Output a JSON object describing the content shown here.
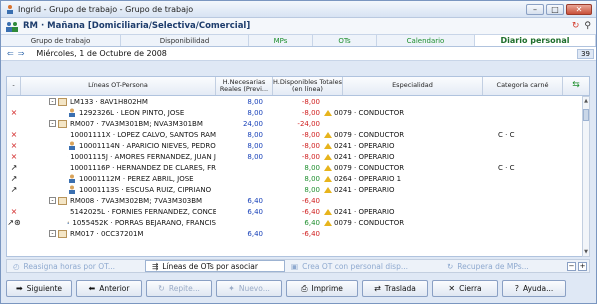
{
  "window": {
    "title": "Ingrid - Grupo de trabajo - Grupo de trabajo"
  },
  "header": {
    "title": "RM · Mañana [Domiciliaria/Selectiva/Comercial]"
  },
  "tabs": [
    {
      "label": "Grupo de trabajo",
      "style": "normal"
    },
    {
      "label": "Disponibilidad",
      "style": "normal"
    },
    {
      "label": "MPs",
      "style": "green"
    },
    {
      "label": "OTs",
      "style": "green"
    },
    {
      "label": "Calendario",
      "style": "green"
    },
    {
      "label": "Diario personal",
      "style": "active"
    }
  ],
  "datebar": {
    "date": "Miércoles, 1 de Octubre de 2008",
    "week": "39"
  },
  "columns": {
    "c0": "-",
    "c1": "Líneas OT-Persona",
    "c2": "H.Necesarias Reales (Previ...",
    "c3": "H.Disponibles Totales (en línea)",
    "c4": "Especialidad",
    "c5": "Categoría carné"
  },
  "rows": [
    {
      "mark": "",
      "level": 1,
      "expand": "-",
      "icon": "route",
      "text": "LM133 · 8AV1H802HM",
      "nec": "8,00",
      "disp": "-8,00",
      "disp_color": "red",
      "warn": false,
      "esp": "",
      "cat": ""
    },
    {
      "mark": "×",
      "mark_color": "red",
      "level": 2,
      "expand": "",
      "icon": "person",
      "text": "1292326L · LEON PINTO, JOSE",
      "nec": "8,00",
      "disp": "-8,00",
      "disp_color": "red",
      "warn": true,
      "esp": "0079 · CONDUCTOR",
      "cat": ""
    },
    {
      "mark": "",
      "level": 1,
      "expand": "-",
      "icon": "route",
      "text": "RM007 · 7VA3M301BM; NVA3M301BM",
      "nec": "24,00",
      "disp": "-24,00",
      "disp_color": "red",
      "warn": false,
      "esp": "",
      "cat": ""
    },
    {
      "mark": "×",
      "mark_color": "red",
      "level": 2,
      "expand": "",
      "icon": "person",
      "text": "10001111X · LOPEZ CALVO, SANTOS RAM",
      "nec": "8,00",
      "disp": "-8,00",
      "disp_color": "red",
      "warn": true,
      "esp": "0079 · CONDUCTOR",
      "cat": "C · C"
    },
    {
      "mark": "×",
      "mark_color": "red",
      "level": 2,
      "expand": "",
      "icon": "person",
      "text": "10001114N · APARICIO NIEVES, PEDRO",
      "nec": "8,00",
      "disp": "-8,00",
      "disp_color": "red",
      "warn": true,
      "esp": "0241 · OPERARIO",
      "cat": ""
    },
    {
      "mark": "×",
      "mark_color": "red",
      "level": 2,
      "expand": "",
      "icon": "person",
      "text": "10001115J · AMORES FERNANDEZ, JUAN J",
      "nec": "8,00",
      "disp": "-8,00",
      "disp_color": "red",
      "warn": true,
      "esp": "0241 · OPERARIO",
      "cat": ""
    },
    {
      "mark": "↗",
      "mark_color": "black",
      "level": 2,
      "expand": "",
      "icon": "person",
      "text": "10001116P · HERNANDEZ DE CLARES, FR/",
      "nec": "",
      "disp": "8,00",
      "disp_color": "green",
      "warn": true,
      "esp": "0079 · CONDUCTOR",
      "cat": "C · C"
    },
    {
      "mark": "↗",
      "mark_color": "black",
      "level": 2,
      "expand": "",
      "icon": "person",
      "text": "10001112M · PEREZ ABRIL, JOSE",
      "nec": "",
      "disp": "8,00",
      "disp_color": "green",
      "warn": true,
      "esp": "0264 · OPERARIO 1",
      "cat": ""
    },
    {
      "mark": "↗",
      "mark_color": "black",
      "level": 2,
      "expand": "",
      "icon": "person",
      "text": "10001113S · ESCUSA RUIZ, CIPRIANO",
      "nec": "",
      "disp": "8,00",
      "disp_color": "green",
      "warn": true,
      "esp": "0241 · OPERARIO",
      "cat": ""
    },
    {
      "mark": "",
      "level": 1,
      "expand": "-",
      "icon": "route",
      "text": "RM008 · 7VA3M302BM; 7VA3M303BM",
      "nec": "6,40",
      "disp": "-6,40",
      "disp_color": "red",
      "warn": false,
      "esp": "",
      "cat": ""
    },
    {
      "mark": "×",
      "mark_color": "red",
      "level": 2,
      "expand": "",
      "icon": "person",
      "text": "5142025L · FORNIES FERNANDEZ, CONCE",
      "nec": "6,40",
      "disp": "-6,40",
      "disp_color": "red",
      "warn": true,
      "esp": "0241 · OPERARIO",
      "cat": ""
    },
    {
      "mark": "↗⊛",
      "mark_color": "black",
      "level": 2,
      "expand": "",
      "icon": "person",
      "text": "1055452K · PORRAS BEJARANO, FRANCIS",
      "nec": "",
      "disp": "6,40",
      "disp_color": "green",
      "warn": true,
      "esp": "0079 · CONDUCTOR",
      "cat": ""
    },
    {
      "mark": "",
      "level": 1,
      "expand": "-",
      "icon": "route",
      "text": "RM017 · 0CC37201M",
      "nec": "6,40",
      "disp": "-6,40",
      "disp_color": "red",
      "warn": false,
      "esp": "",
      "cat": ""
    }
  ],
  "toolbar2": [
    {
      "label": "Reasigna horas por OT...",
      "enabled": false,
      "icon": "clock-icon"
    },
    {
      "label": "Líneas de OTs por asociar",
      "enabled": true,
      "icon": "link-icon"
    },
    {
      "label": "Crea OT con personal disp...",
      "enabled": false,
      "icon": "create-icon"
    },
    {
      "label": "Recupera de MPs...",
      "enabled": false,
      "icon": "refresh-icon"
    }
  ],
  "buttons": [
    {
      "label": "Siguiente",
      "enabled": true,
      "icon": "arrow-right-icon",
      "glyph": "➡"
    },
    {
      "label": "Anterior",
      "enabled": true,
      "icon": "arrow-left-icon",
      "glyph": "⬅"
    },
    {
      "label": "Repite...",
      "enabled": false,
      "icon": "repeat-icon",
      "glyph": "↻"
    },
    {
      "label": "Nuevo...",
      "enabled": false,
      "icon": "new-icon",
      "glyph": "✦"
    },
    {
      "label": "Imprime",
      "enabled": true,
      "icon": "printer-icon",
      "glyph": "⎙"
    },
    {
      "label": "Traslada",
      "enabled": true,
      "icon": "move-icon",
      "glyph": "⇄"
    },
    {
      "label": "Cierra",
      "enabled": true,
      "icon": "close-icon",
      "glyph": "✕"
    },
    {
      "label": "Ayuda...",
      "enabled": true,
      "icon": "help-icon",
      "glyph": "?"
    }
  ]
}
